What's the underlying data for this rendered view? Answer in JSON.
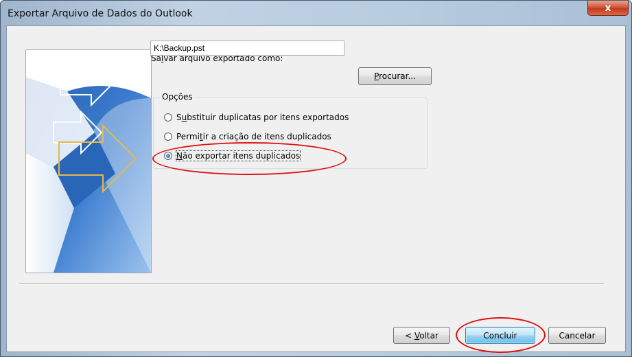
{
  "window": {
    "title": "Exportar Arquivo de Dados do Outlook",
    "close_glyph": "x"
  },
  "save": {
    "label_pre": "Sa",
    "label_key": "l",
    "label_post": "var arquivo exportado como:",
    "path_value": "K:\\Backup.pst",
    "browse_key": "P",
    "browse_rest": "rocurar..."
  },
  "options": {
    "title": "Opções",
    "items": [
      {
        "pre": "S",
        "key": "u",
        "post": "bstituir duplicatas por itens exportados",
        "selected": false
      },
      {
        "pre": "Permi",
        "key": "t",
        "post": "ir a criação de itens duplicados",
        "selected": false
      },
      {
        "pre": "",
        "key": "N",
        "post": "ão exportar itens duplicados",
        "selected": true
      }
    ]
  },
  "footer": {
    "back_pre": "< ",
    "back_key": "V",
    "back_post": "oltar",
    "finish": "Concluir",
    "cancel": "Cancelar"
  },
  "colors": {
    "highlight": "#e01010",
    "accent": "#3c7fb1"
  }
}
